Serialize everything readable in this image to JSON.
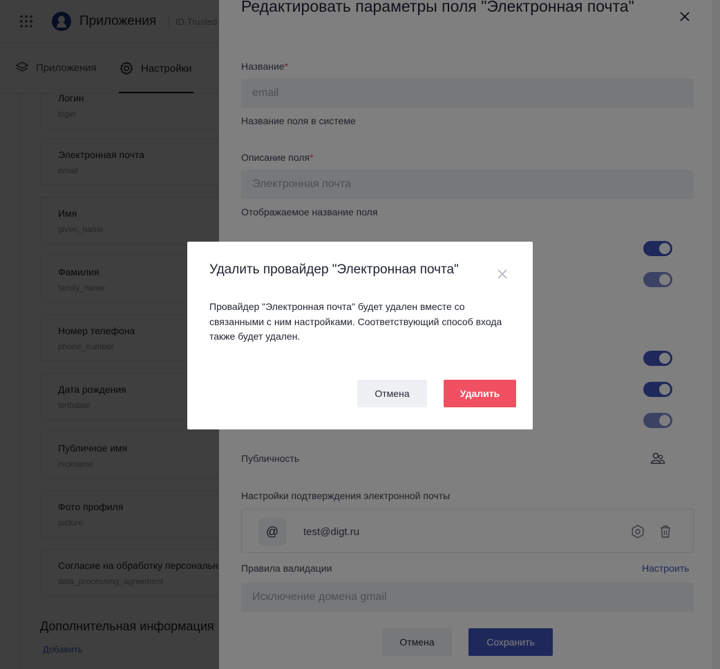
{
  "header": {
    "app_title": "Приложения",
    "app_subtitle": "ID.Trusted"
  },
  "nav": {
    "items": [
      {
        "label": "Приложения",
        "icon": "layers-icon"
      },
      {
        "label": "Настройки",
        "icon": "gear-icon",
        "active": true
      }
    ]
  },
  "fields": [
    {
      "title": "Логин",
      "key": "login"
    },
    {
      "title": "Электронная почта",
      "key": "email"
    },
    {
      "title": "Имя",
      "key": "given_name"
    },
    {
      "title": "Фамилия",
      "key": "family_name"
    },
    {
      "title": "Номер телефона",
      "key": "phone_number"
    },
    {
      "title": "Дата рождения",
      "key": "birthdate"
    },
    {
      "title": "Публичное имя",
      "key": "nickname"
    },
    {
      "title": "Фото профиля",
      "key": "picture"
    },
    {
      "title": "Согласие на обработку персональных данных",
      "key": "data_processing_agreement"
    }
  ],
  "section": {
    "title": "Дополнительная информация",
    "add_link": "Добавить"
  },
  "drawer": {
    "title": "Редактировать параметры поля \"Электронная почта\"",
    "name_label": "Название",
    "name_value": "email",
    "name_hint": "Название поля в системе",
    "desc_label": "Описание поля",
    "desc_value": "Электронная почта",
    "desc_hint": "Отображаемое название поля",
    "publicity_label": "Публичность",
    "confirm_label": "Настройки подтверждения электронной почты",
    "confirm_email": "test@digt.ru",
    "validation_label": "Правила валидации",
    "configure_link": "Настроить",
    "validation_placeholder": "Исключение домена gmail",
    "cancel_label": "Отмена",
    "save_label": "Сохранить"
  },
  "modal": {
    "title": "Удалить провайдер \"Электронная почта\"",
    "body": "Провайдер \"Электронная почта\" будет удален вместе со связанными с ним настройками. Соответствующий способ входа также будет удален.",
    "cancel_label": "Отмена",
    "delete_label": "Удалить"
  },
  "colors": {
    "primary": "#3f51b5",
    "danger": "#f15062",
    "required_star": "#e84451"
  }
}
